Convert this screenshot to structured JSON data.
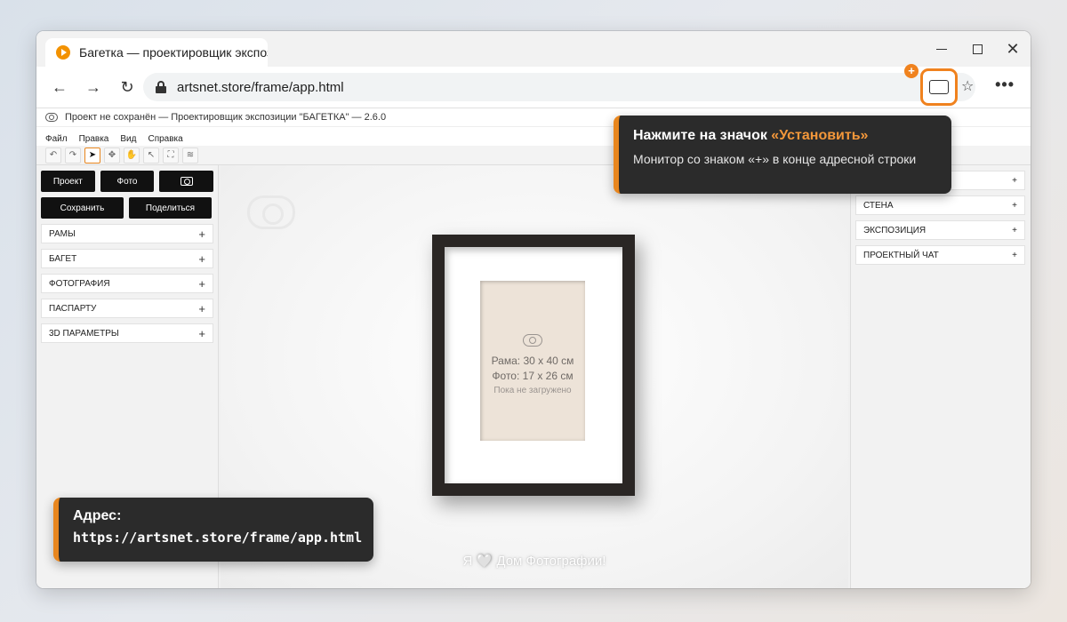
{
  "browser": {
    "tab_title": "Багетка — проектировщик экспоз",
    "url": "artsnet.store/frame/app.html",
    "install_badge": "+",
    "back": "←",
    "forward": "→",
    "reload": "↻",
    "star": "☆",
    "menu": "•••",
    "close": "✕"
  },
  "app": {
    "title": "Проект не сохранён — Проектировщик экспозиции \"БАГЕТКА\" — 2.6.0",
    "menu": [
      "Файл",
      "Правка",
      "Вид",
      "Справка"
    ],
    "tools": [
      "↶",
      "↷",
      "➤",
      "✥",
      "✋",
      "↖",
      "⛶",
      "≋"
    ],
    "left": {
      "btn_project": "Проект",
      "btn_photo": "Фото",
      "btn_save": "Сохранить",
      "btn_share": "Поделиться",
      "sections": [
        "РАМЫ",
        "БАГЕТ",
        "ФОТОГРАФИЯ",
        "ПАСПАРТУ",
        "3D ПАРАМЕТРЫ"
      ]
    },
    "right": {
      "sections": [
        "",
        "СТЕНА",
        "ЭКСПОЗИЦИЯ",
        "ПРОЕКТНЫЙ ЧАТ"
      ]
    },
    "plus": "+",
    "canvas": {
      "frame_size": "Рама: 30 х 40 см",
      "photo_size": "Фото: 17 х 26 см",
      "photo_status": "Пока не загружено",
      "footer": "Я 🤍 Дом Фотографии!"
    }
  },
  "overlays": {
    "install_tip": {
      "heading_prefix": "Нажмите на значок ",
      "heading_accent": "«Установить»",
      "body": "Монитор со знаком «+» в конце адресной строки"
    },
    "address_tip": {
      "label": "Адрес:",
      "url": "https://artsnet.store/frame/app.html"
    }
  },
  "colors": {
    "accent": "#e8861e",
    "tooltip_bg": "#2b2b2b",
    "frame": "#2a2624",
    "photo_placeholder": "#ede3d8"
  }
}
